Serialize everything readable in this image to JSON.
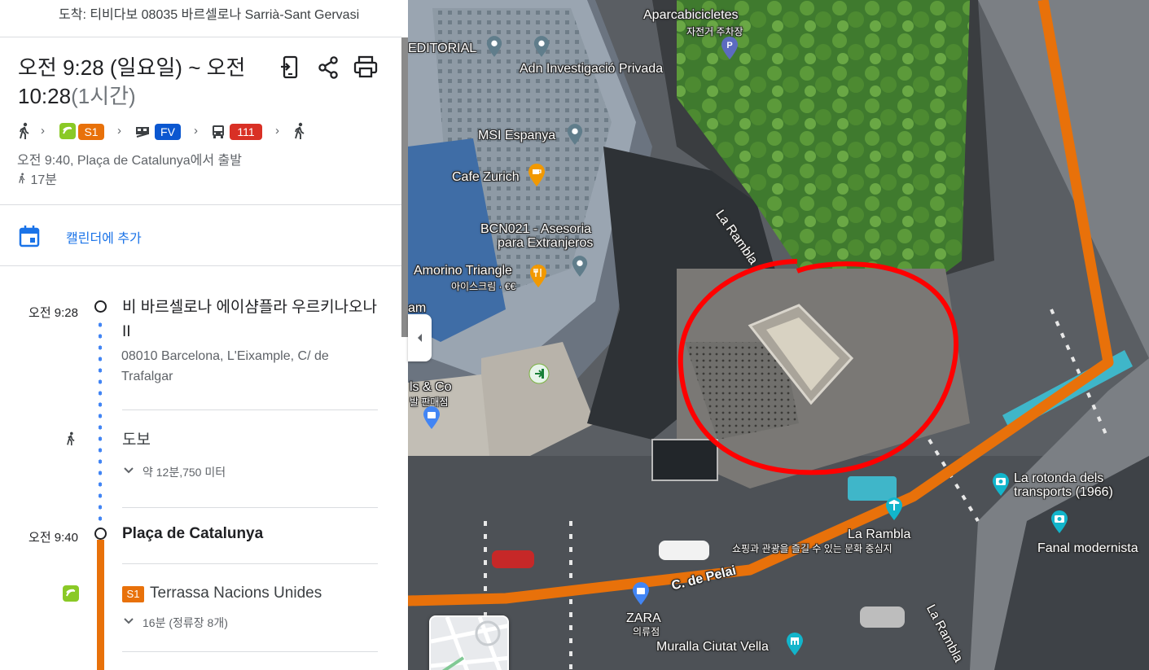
{
  "destination": "도착: 티비다보 08035 바르셀로나 Sarrià-Sant Gervasi",
  "trip": {
    "time_range": "오전 9:28 (일요일) ~ 오전 10:28",
    "duration": "(1시간)",
    "steps": {
      "train_line": "S1",
      "train_line_color": "#e8710a",
      "fv_line": "FV",
      "fv_color": "#0b57d0",
      "bus_line": "111",
      "bus_color": "#d93025"
    },
    "depart_text": "오전 9:40, Plaça de Catalunya에서 출발",
    "walk_total": "17분"
  },
  "header_icons": [
    "send-to-phone-icon",
    "share-icon",
    "print-icon"
  ],
  "calendar": {
    "label": "캘린더에 추가",
    "icon": "calendar-icon"
  },
  "timeline": {
    "start": {
      "time": "오전 9:28",
      "name": "비 바르셀로나 에이샴플라 우르키나오나 II",
      "address": "08010 Barcelona, L'Eixample, C/ de Trafalgar"
    },
    "walk": {
      "label": "도보",
      "detail": "약 12분,750 미터"
    },
    "stop2": {
      "time": "오전 9:40",
      "name": "Plaça de Catalunya"
    },
    "train": {
      "line": "S1",
      "destination": "Terrassa Nacions Unides",
      "detail": "16분 (정류장 8개)"
    }
  },
  "map": {
    "route_color": "#e8710a",
    "annotation_color": "#ff0000",
    "labels": {
      "aparcabicicletes": "Aparcabicicletes",
      "aparcabicicletes_ko": "자전거 주차장",
      "editorial": "EDITORIAL",
      "adn": "Adn Investigació Privada",
      "msi": "MSI Espanya",
      "cafe_zurich": "Cafe Zurich",
      "bcn021_1": "BCN021 - Asesoria",
      "bcn021_2": "para Extranjeros",
      "amorino": "Amorino Triangle",
      "amorino_ko": "아이스크림 · €€",
      "la_rambla_street": "La Rambla",
      "am": "am",
      "ls_co": "ls & Co",
      "ls_co_ko": "발 판매점",
      "la_rotonda_1": "La rotonda dels",
      "la_rotonda_2": "transports (1966)",
      "la_rambla": "La Rambla",
      "la_rambla_ko": "쇼핑과 관광을 즐길 수 있는 문화 중심지",
      "fanal": "Fanal modernista",
      "c_de_pelai": "C. de Pelai",
      "zara": "ZARA",
      "zara_ko": "의류점",
      "muralla": "Muralla Ciutat Vella",
      "la_rambla_bottom": "La Rambla"
    }
  }
}
